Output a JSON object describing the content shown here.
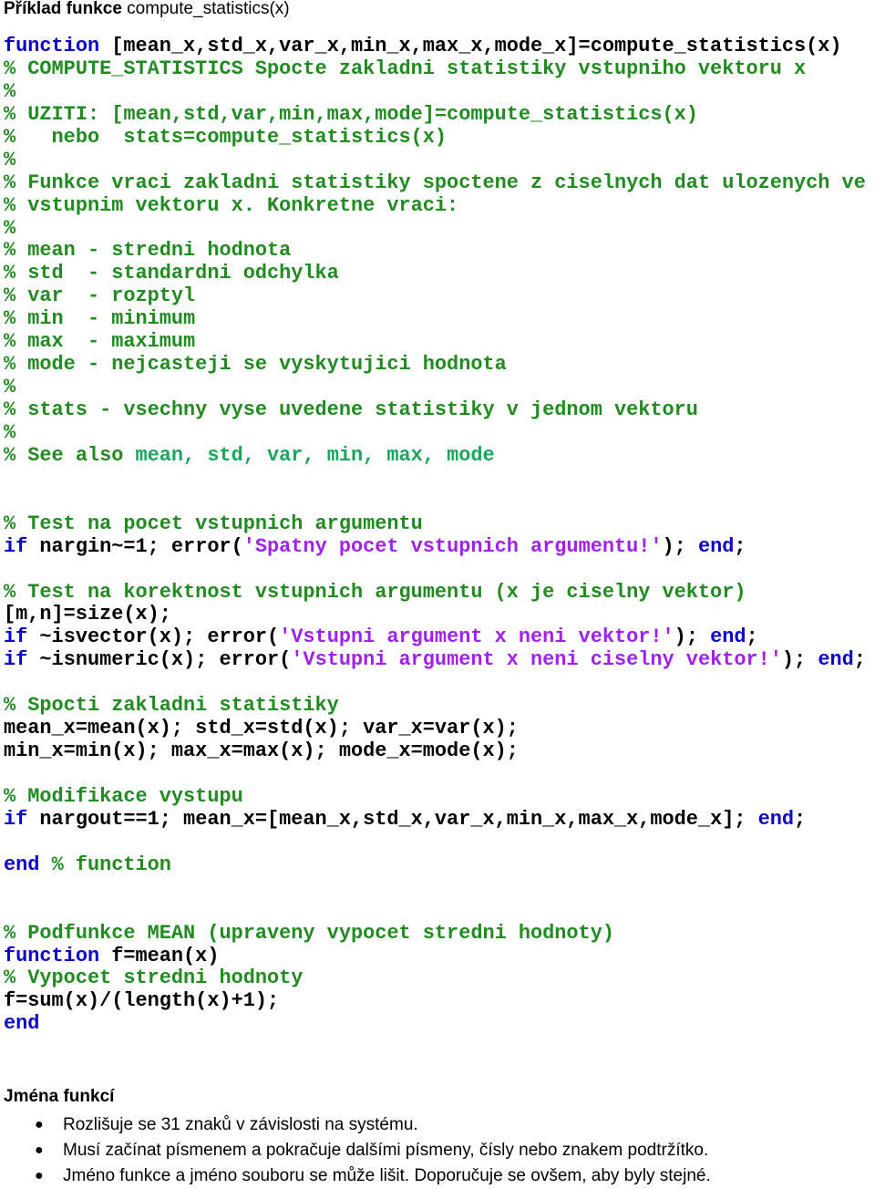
{
  "title": {
    "bold": "Příklad funkce",
    "rest": " compute_statistics(x)"
  },
  "colors": {
    "keyword": "#0b00c8",
    "comment": "#218a21",
    "comment_link": "#17a65a",
    "string": "#a020f0",
    "plain": "#000000"
  },
  "code_lines": [
    [
      {
        "t": "kw",
        "s": "function"
      },
      {
        "t": "pl",
        "s": " [mean_x,std_x,var_x,min_x,max_x,mode_x]=compute_statistics(x)"
      }
    ],
    [
      {
        "t": "cm",
        "s": "% COMPUTE_STATISTICS Spocte zakladni statistiky vstupniho vektoru x"
      }
    ],
    [
      {
        "t": "cm",
        "s": "%"
      }
    ],
    [
      {
        "t": "cm",
        "s": "% UZITI: [mean,std,var,min,max,mode]=compute_statistics(x)"
      }
    ],
    [
      {
        "t": "cm",
        "s": "%   nebo  stats=compute_statistics(x)"
      }
    ],
    [
      {
        "t": "cm",
        "s": "%"
      }
    ],
    [
      {
        "t": "cm",
        "s": "% Funkce vraci zakladni statistiky spoctene z ciselnych dat ulozenych ve"
      }
    ],
    [
      {
        "t": "cm",
        "s": "% vstupnim vektoru x. Konkretne vraci:"
      }
    ],
    [
      {
        "t": "cm",
        "s": "%"
      }
    ],
    [
      {
        "t": "cm",
        "s": "% mean - stredni hodnota"
      }
    ],
    [
      {
        "t": "cm",
        "s": "% std  - standardni odchylka"
      }
    ],
    [
      {
        "t": "cm",
        "s": "% var  - rozptyl"
      }
    ],
    [
      {
        "t": "cm",
        "s": "% min  - minimum"
      }
    ],
    [
      {
        "t": "cm",
        "s": "% max  - maximum"
      }
    ],
    [
      {
        "t": "cm",
        "s": "% mode - nejcasteji se vyskytujici hodnota"
      }
    ],
    [
      {
        "t": "cm",
        "s": "%"
      }
    ],
    [
      {
        "t": "cm",
        "s": "% stats - vsechny vyse uvedene statistiky v jednom vektoru"
      }
    ],
    [
      {
        "t": "cm",
        "s": "%"
      }
    ],
    [
      {
        "t": "cm",
        "s": "% See also "
      },
      {
        "t": "cm2",
        "s": "mean, std, var, min, max, mode"
      }
    ],
    [],
    [],
    [
      {
        "t": "cm",
        "s": "% Test na pocet vstupnich argumentu"
      }
    ],
    [
      {
        "t": "kw",
        "s": "if"
      },
      {
        "t": "pl",
        "s": " nargin~=1; error("
      },
      {
        "t": "st",
        "s": "'Spatny pocet vstupnich argumentu!'"
      },
      {
        "t": "pl",
        "s": "); "
      },
      {
        "t": "kw",
        "s": "end"
      },
      {
        "t": "pl",
        "s": ";"
      }
    ],
    [],
    [
      {
        "t": "cm",
        "s": "% Test na korektnost vstupnich argumentu (x je ciselny vektor)"
      }
    ],
    [
      {
        "t": "pl",
        "s": "[m,n]=size(x);"
      }
    ],
    [
      {
        "t": "kw",
        "s": "if"
      },
      {
        "t": "pl",
        "s": " ~isvector(x); error("
      },
      {
        "t": "st",
        "s": "'Vstupni argument x neni vektor!'"
      },
      {
        "t": "pl",
        "s": "); "
      },
      {
        "t": "kw",
        "s": "end"
      },
      {
        "t": "pl",
        "s": ";"
      }
    ],
    [
      {
        "t": "kw",
        "s": "if"
      },
      {
        "t": "pl",
        "s": " ~isnumeric(x); error("
      },
      {
        "t": "st",
        "s": "'Vstupni argument x neni ciselny vektor!'"
      },
      {
        "t": "pl",
        "s": "); "
      },
      {
        "t": "kw",
        "s": "end"
      },
      {
        "t": "pl",
        "s": ";"
      }
    ],
    [],
    [
      {
        "t": "cm",
        "s": "% Spocti zakladni statistiky"
      }
    ],
    [
      {
        "t": "pl",
        "s": "mean_x=mean(x); std_x=std(x); var_x=var(x);"
      }
    ],
    [
      {
        "t": "pl",
        "s": "min_x=min(x); max_x=max(x); mode_x=mode(x);"
      }
    ],
    [],
    [
      {
        "t": "cm",
        "s": "% Modifikace vystupu"
      }
    ],
    [
      {
        "t": "kw",
        "s": "if"
      },
      {
        "t": "pl",
        "s": " nargout==1; mean_x=[mean_x,std_x,var_x,min_x,max_x,mode_x]; "
      },
      {
        "t": "kw",
        "s": "end"
      },
      {
        "t": "pl",
        "s": ";"
      }
    ],
    [],
    [
      {
        "t": "kw",
        "s": "end"
      },
      {
        "t": "pl",
        "s": " "
      },
      {
        "t": "cm",
        "s": "% function"
      }
    ],
    [],
    [],
    [
      {
        "t": "cm",
        "s": "% Podfunkce MEAN (upraveny vypocet stredni hodnoty)"
      }
    ],
    [
      {
        "t": "kw",
        "s": "function"
      },
      {
        "t": "pl",
        "s": " f=mean(x)"
      }
    ],
    [
      {
        "t": "cm",
        "s": "% Vypocet stredni hodnoty"
      }
    ],
    [
      {
        "t": "pl",
        "s": "f=sum(x)/(length(x)+1);"
      }
    ],
    [
      {
        "t": "kw",
        "s": "end"
      }
    ]
  ],
  "notes": {
    "heading": "Jména funkcí",
    "bullet_icon": "bullet-dot",
    "items": [
      "Rozlišuje se 31 znaků v závislosti na systému.",
      "Musí začínat písmenem a pokračuje dalšími písmeny, čísly nebo znakem podtržítko.",
      "Jméno funkce a jméno souboru se může lišit. Doporučuje se ovšem, aby byly stejné."
    ]
  }
}
